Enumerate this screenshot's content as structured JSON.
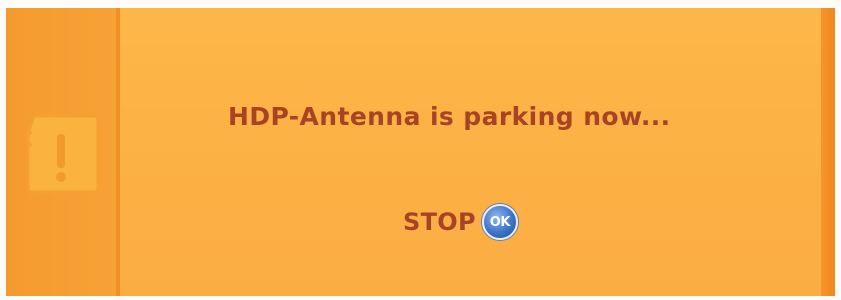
{
  "dialog": {
    "message": "HDP-Antenna is parking now...",
    "stop_label": "STOP",
    "ok_label": "OK",
    "icon": "warning-exclamation-icon"
  },
  "colors": {
    "background": "#fdb245",
    "side_strip": "#f59a2f",
    "text": "#a84326",
    "ok_button": "#3e74c8"
  }
}
